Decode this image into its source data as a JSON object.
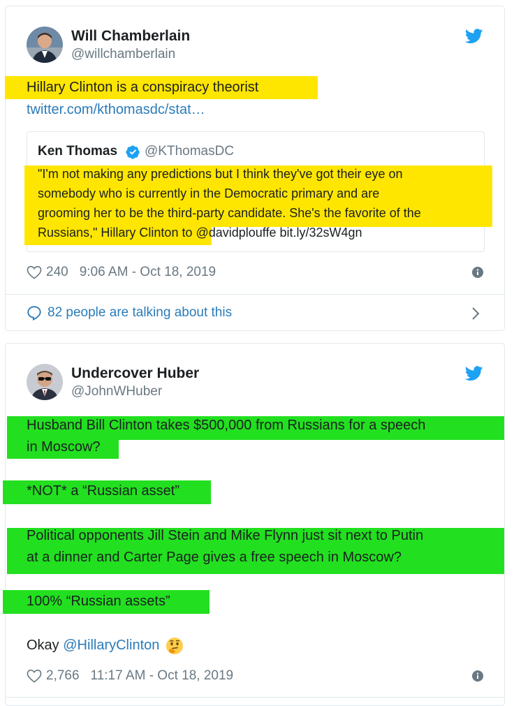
{
  "tweet1": {
    "author_name": "Will Chamberlain",
    "author_handle": "@willchamberlain",
    "text_line1": "Hillary Clinton is a conspiracy theorist",
    "link": "twitter.com/kthomasdc/stat…",
    "quote": {
      "author_name": "Ken Thomas",
      "author_handle": "@KThomasDC",
      "lines": [
        "\"I'm not making any predictions but I think they've got their eye on",
        "somebody who is currently in the Democratic primary and are",
        "grooming her to be the third-party candidate. She's the favorite of the"
      ],
      "last_line_text": "Russians,\" Hillary Clinton to ",
      "last_line_mention": "@davidplouffe",
      "last_line_link": " bit.ly/32sW4gn"
    },
    "likes": "240",
    "timestamp": "9:06 AM - Oct 18, 2019",
    "talking": "82 people are talking about this"
  },
  "tweet2": {
    "author_name": "Undercover Huber",
    "author_handle": "@JohnWHuber",
    "lines": [
      "Husband Bill Clinton takes $500,000 from Russians for a speech",
      "in Moscow?",
      "*NOT* a “Russian asset”",
      "Political opponents Jill Stein and Mike Flynn just sit next to Putin",
      "at a dinner and Carter Page gives a free speech in Moscow?",
      "100% “Russian assets”"
    ],
    "last_text": "Okay ",
    "last_mention": "@HillaryClinton",
    "likes": "2,766",
    "timestamp": "11:17 AM - Oct 18, 2019"
  },
  "colors": {
    "highlight_yellow": "#ffe600",
    "highlight_green": "#22e01f",
    "link_blue": "#2b7bb9",
    "twitter_blue": "#1da1f2"
  },
  "icons": [
    "twitter-bird-icon",
    "verified-badge-icon",
    "heart-icon",
    "info-icon",
    "speech-bubble-icon",
    "chevron-right-icon",
    "thinking-face-emoji"
  ]
}
